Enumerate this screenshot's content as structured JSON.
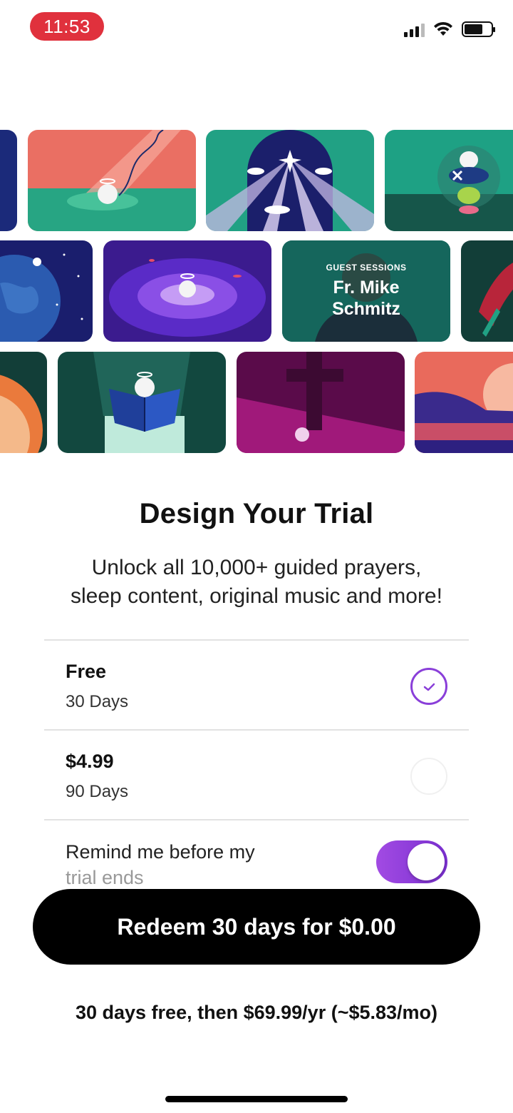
{
  "status_bar": {
    "time": "11:53",
    "icons": [
      "cellular-signal-icon",
      "wifi-icon",
      "battery-icon"
    ]
  },
  "banner": {
    "guest_tile": {
      "label": "GUEST SESSIONS",
      "name_line1": "Fr. Mike",
      "name_line2": "Schmitz"
    }
  },
  "content": {
    "title": "Design Your Trial",
    "subtitle_line1": "Unlock all 10,000+ guided prayers,",
    "subtitle_line2": "sleep content, original music and more!"
  },
  "options": [
    {
      "price": "Free",
      "duration": "30 Days",
      "selected": true
    },
    {
      "price": "$4.99",
      "duration": "90 Days",
      "selected": false
    }
  ],
  "reminder": {
    "line1": "Remind me before my",
    "line2": "trial ends",
    "enabled": true
  },
  "cta": {
    "label": "Redeem 30 days for $0.00"
  },
  "fine_print": "30 days free, then $69.99/yr (~$5.83/mo)",
  "colors": {
    "accent_purple": "#8a3fd9",
    "time_pill": "#e0313d",
    "cta_background": "#000000"
  }
}
